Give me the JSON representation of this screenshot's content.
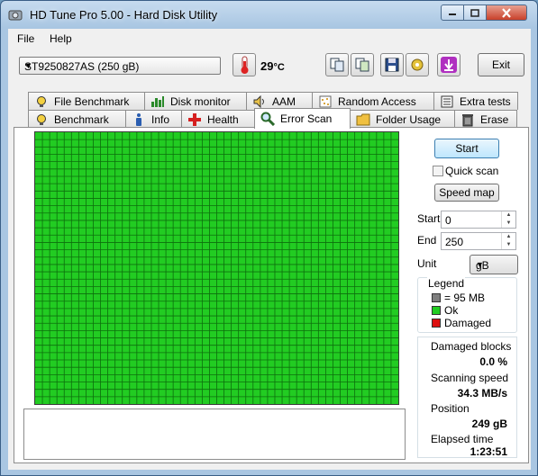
{
  "window": {
    "title": "HD Tune Pro 5.00 - Hard Disk Utility"
  },
  "menu": {
    "file": "File",
    "help": "Help"
  },
  "toolbar": {
    "drive": "ST9250827AS (250 gB)",
    "temperature": "29",
    "temp_unit": "°C",
    "exit_label": "Exit"
  },
  "tabs_top": [
    {
      "label": "File Benchmark",
      "icon": "file-benchmark-icon"
    },
    {
      "label": "Disk monitor",
      "icon": "disk-monitor-icon"
    },
    {
      "label": "AAM",
      "icon": "speaker-icon"
    },
    {
      "label": "Random Access",
      "icon": "random-access-icon"
    },
    {
      "label": "Extra tests",
      "icon": "extra-tests-icon"
    }
  ],
  "tabs_bottom": [
    {
      "label": "Benchmark",
      "icon": "benchmark-icon"
    },
    {
      "label": "Info",
      "icon": "info-icon"
    },
    {
      "label": "Health",
      "icon": "health-icon"
    },
    {
      "label": "Error Scan",
      "icon": "magnifier-icon",
      "active": true
    },
    {
      "label": "Folder Usage",
      "icon": "folder-icon"
    },
    {
      "label": "Erase",
      "icon": "trash-icon"
    }
  ],
  "scan": {
    "start_button": "Start",
    "quick_scan_label": "Quick scan",
    "quick_scan_checked": false,
    "speed_map_button": "Speed map",
    "start_label": "Start",
    "start_value": "0",
    "end_label": "End",
    "end_value": "250",
    "unit_label": "Unit",
    "unit_value": "gB",
    "block_color": "#22cc22",
    "block_status": "ok"
  },
  "legend": {
    "title": "Legend",
    "block_size": "= 95 MB",
    "ok": "Ok",
    "damaged": "Damaged",
    "colors": {
      "block": "#7f7f7f",
      "ok": "#22cc22",
      "damaged": "#dd1111"
    }
  },
  "stats": {
    "damaged_label": "Damaged blocks",
    "damaged_value": "0.0 %",
    "speed_label": "Scanning speed",
    "speed_value": "34.3 MB/s",
    "position_label": "Position",
    "position_value": "249 gB",
    "elapsed_label": "Elapsed time",
    "elapsed_value": "1:23:51"
  }
}
